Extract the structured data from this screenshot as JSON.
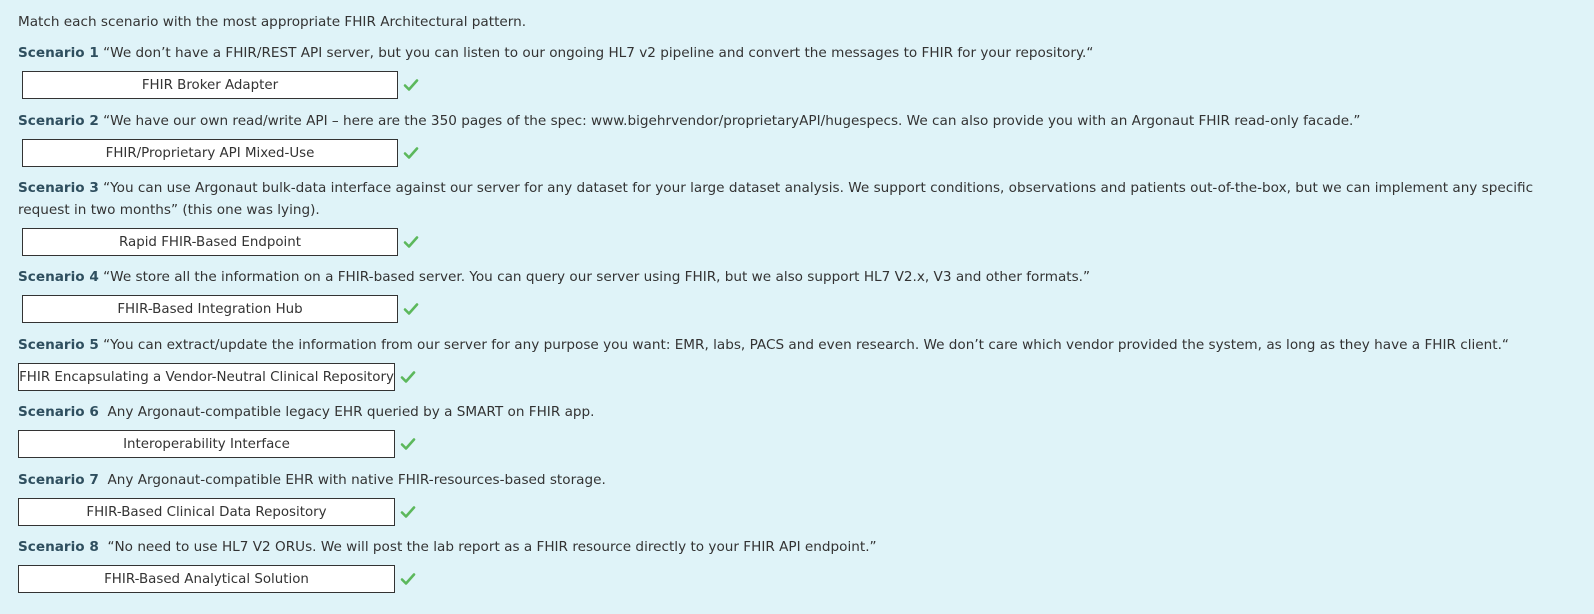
{
  "instructions": "Match each scenario with the most appropriate FHIR Architectural pattern.",
  "scenarios": [
    {
      "label": "Scenario 1",
      "text": "“We don’t have a FHIR/REST API server, but you can listen to our ongoing HL7 v2 pipeline and convert the messages to FHIR for your repository.“",
      "answer": "FHIR Broker Adapter",
      "status": "correct"
    },
    {
      "label": "Scenario 2",
      "text": "“We have our own read/write API – here are the 350 pages of the spec: www.bigehrvendor/proprietaryAPI/hugespecs. We can also provide you with an Argonaut FHIR read-only facade.”",
      "answer": "FHIR/Proprietary API Mixed-Use",
      "status": "correct"
    },
    {
      "label": "Scenario 3",
      "text": "“You can use Argonaut bulk-data interface against our server for any dataset for your large dataset analysis. We support conditions, observations and patients out-of-the-box, but we can implement any specific request in two months” (this one was lying).",
      "answer": "Rapid FHIR-Based Endpoint",
      "status": "correct"
    },
    {
      "label": "Scenario 4",
      "text": "“We store all the information on a FHIR-based server. You can query our server using FHIR, but we also support HL7 V2.x, V3 and other formats.”",
      "answer": "FHIR-Based Integration Hub",
      "status": "correct"
    },
    {
      "label": "Scenario 5",
      "text": "“You can extract/update the information from our server for any purpose you want: EMR, labs, PACS and even research. We don’t care which vendor provided the system, as long as they have a FHIR client.“",
      "answer": "FHIR Encapsulating a Vendor-Neutral Clinical Repository",
      "status": "correct"
    },
    {
      "label": "Scenario 6",
      "text": "Any Argonaut-compatible legacy EHR queried by a SMART on FHIR app.",
      "answer": "Interoperability Interface",
      "status": "correct"
    },
    {
      "label": "Scenario 7",
      "text": "Any Argonaut-compatible EHR with native FHIR-resources-based storage.",
      "answer": "FHIR-Based Clinical Data Repository",
      "status": "correct"
    },
    {
      "label": "Scenario 8",
      "text": "“No need to use HL7 V2 ORUs. We will post the lab report as a FHIR resource directly to your FHIR API endpoint.”",
      "answer": "FHIR-Based Analytical Solution",
      "status": "correct"
    }
  ],
  "colors": {
    "background": "#dff3f8",
    "label": "#2f4f5f",
    "check": "#5cb85c"
  },
  "icons": {
    "status": "check-icon"
  }
}
